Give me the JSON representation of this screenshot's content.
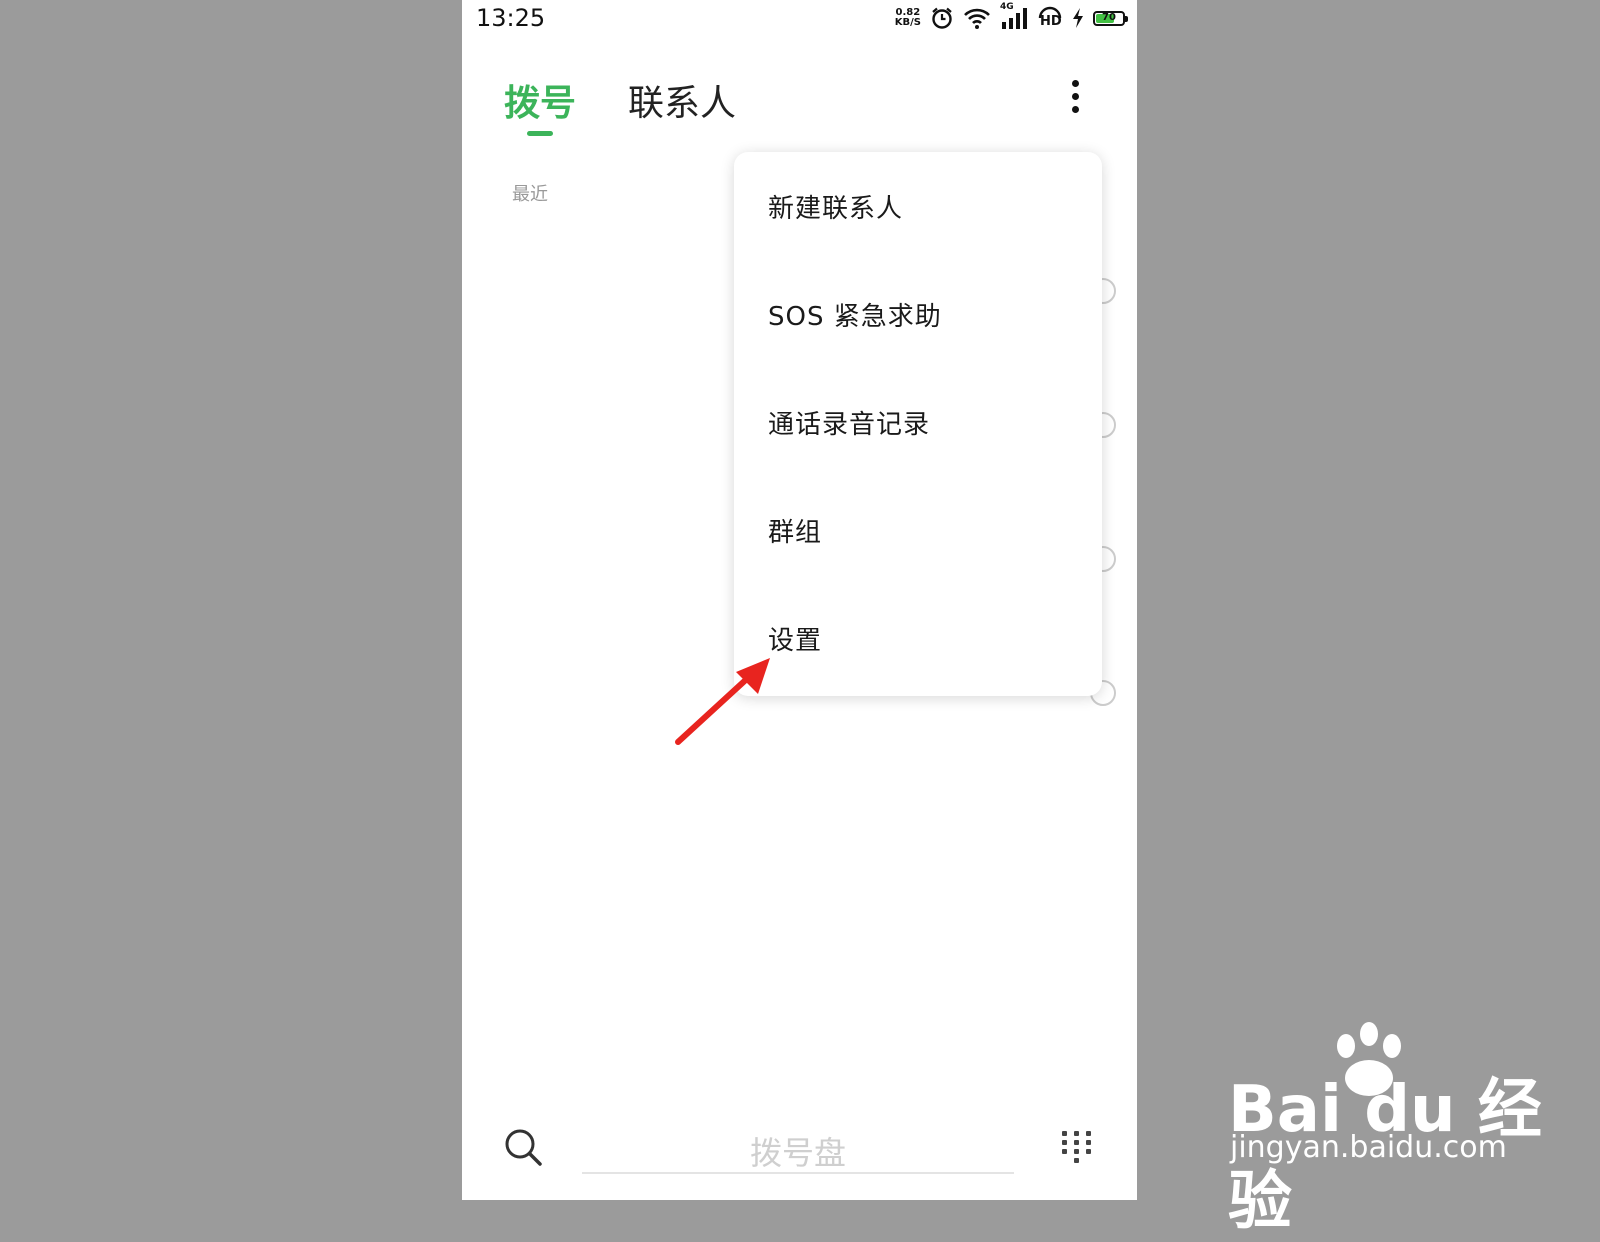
{
  "status_bar": {
    "time": "13:25",
    "net_speed_value": "0.82",
    "net_speed_unit": "KB/S",
    "network_type": "4G",
    "hd_label": "HD",
    "battery_level": "70",
    "battery_fraction": 0.7
  },
  "tabs": [
    {
      "label": "拨号",
      "active": true
    },
    {
      "label": "联系人",
      "active": false
    }
  ],
  "section_label": "最近",
  "menu": {
    "items": [
      {
        "label": "新建联系人"
      },
      {
        "label": "SOS 紧急求助"
      },
      {
        "label": "通话录音记录"
      },
      {
        "label": "群组"
      },
      {
        "label": "设置"
      }
    ]
  },
  "bottom_bar": {
    "dialpad_placeholder": "拨号盘"
  },
  "watermark": {
    "brand": "Bai du 经验",
    "url": "jingyan.baidu.com"
  },
  "colors": {
    "accent": "#3cb45a",
    "annotation_arrow": "#e8241f",
    "background": "#9b9b9b"
  }
}
